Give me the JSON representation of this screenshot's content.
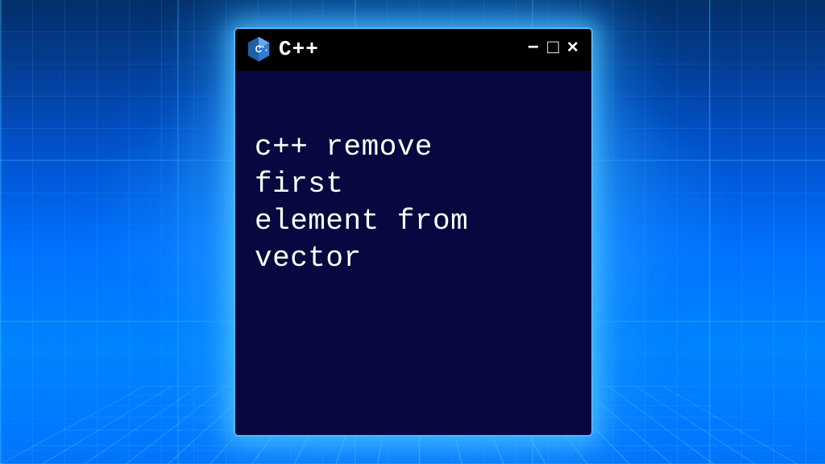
{
  "titlebar": {
    "title": "C++",
    "logo_name": "cpp-logo",
    "controls": {
      "minimize_glyph": "−",
      "maximize_glyph": "□",
      "close_glyph": "×"
    }
  },
  "content": {
    "text": "c++ remove\nfirst\nelement from\nvector"
  },
  "colors": {
    "window_bg": "#06083f",
    "titlebar_bg": "#000000",
    "window_border": "#4fb6ff",
    "text": "#ffffff",
    "glow": "#52c4ff"
  }
}
